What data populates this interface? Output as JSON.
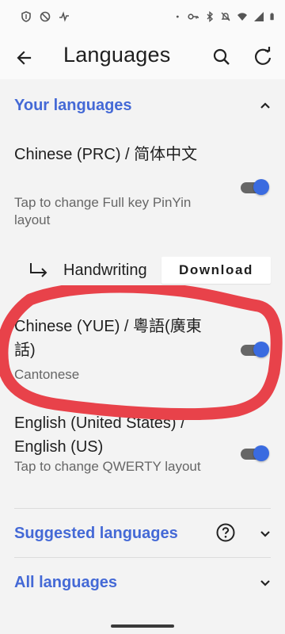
{
  "app_bar": {
    "title": "Languages"
  },
  "your_languages": {
    "title": "Your languages",
    "languages": [
      {
        "title": "Chinese (PRC) / 简体中文",
        "subtitle": "Tap to change Full key PinYin layout",
        "enabled": true
      },
      {
        "title": "Chinese (YUE) / 粵語(廣東話)",
        "subtitle": "Cantonese",
        "enabled": true
      },
      {
        "title": "English (United States) / English (US)",
        "subtitle": "Tap to change QWERTY layout",
        "enabled": true
      }
    ],
    "handwriting": {
      "label": "Handwriting",
      "button": "Download"
    }
  },
  "suggested_languages": {
    "title": "Suggested languages"
  },
  "all_languages": {
    "title": "All languages"
  },
  "colors": {
    "accent": "#4469d6",
    "toggle_thumb": "#3a6be0",
    "annotation": "#e8424a"
  }
}
